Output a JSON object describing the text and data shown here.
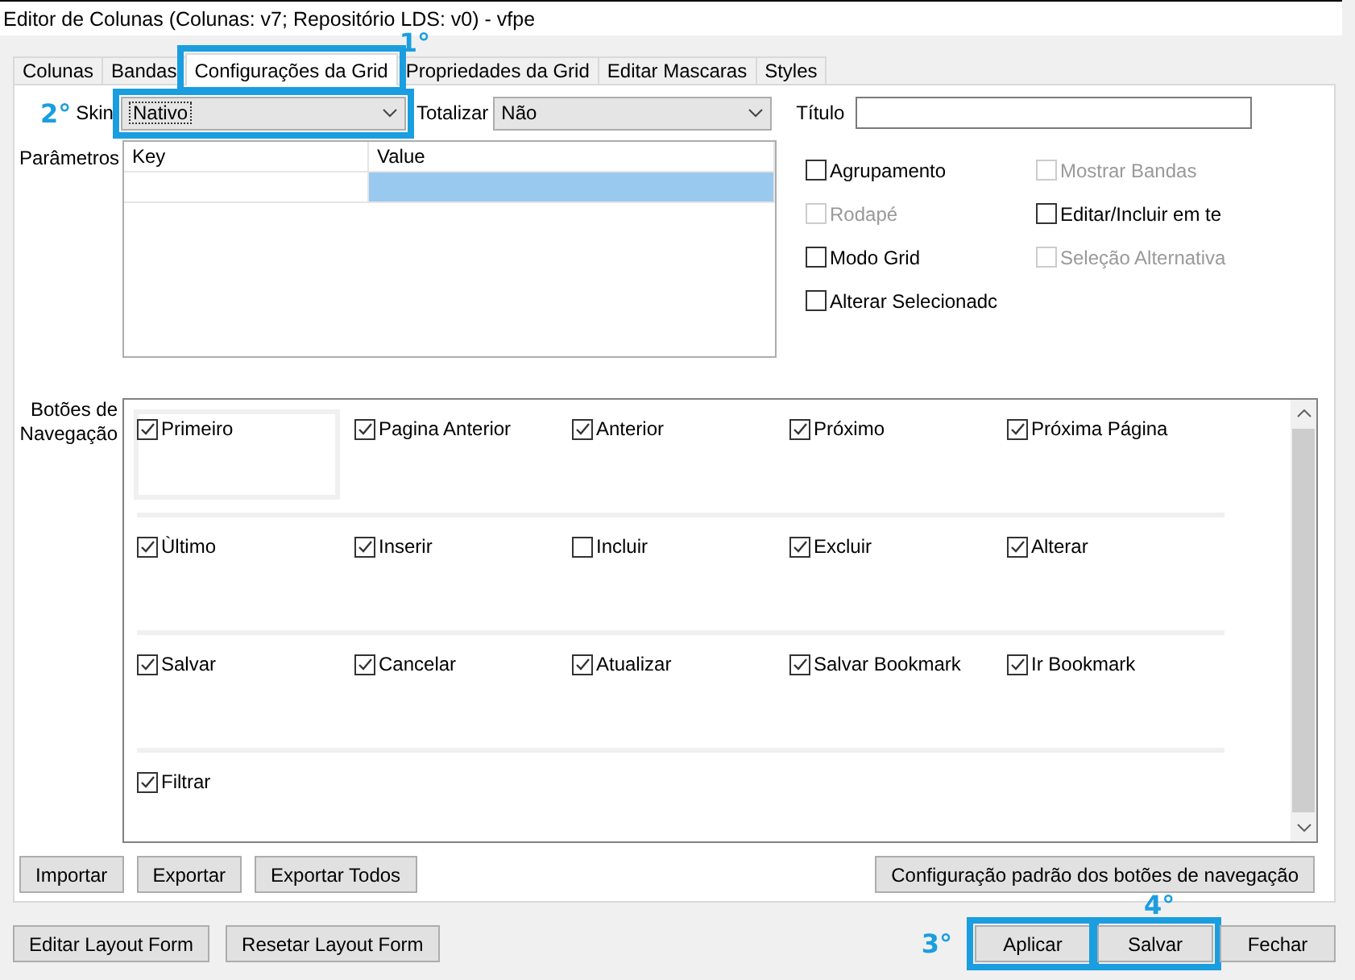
{
  "window": {
    "title": "Editor de Colunas (Colunas: v7; Repositório LDS: v0) - vfpe"
  },
  "tabs": [
    {
      "label": "Colunas",
      "selected": false
    },
    {
      "label": "Bandas",
      "selected": false
    },
    {
      "label": "Configurações da Grid",
      "selected": true,
      "callout": "1°"
    },
    {
      "label": "Propriedades da Grid",
      "selected": false
    },
    {
      "label": "Editar Mascaras",
      "selected": false
    },
    {
      "label": "Styles",
      "selected": false
    }
  ],
  "skin": {
    "label": "Skin",
    "value": "Nativo",
    "callout": "2°"
  },
  "totalizar": {
    "label": "Totalizar",
    "value": "Não"
  },
  "titulo": {
    "label": "Título"
  },
  "parametros": {
    "label": "Parâmetros",
    "columns": [
      "Key",
      "Value"
    ],
    "rows": [
      {
        "cells": [
          {
            "selected": false
          },
          {
            "selected": true
          }
        ]
      }
    ]
  },
  "options": [
    {
      "label": "Agrupamento",
      "checked": false,
      "disabled": false
    },
    {
      "label": "Mostrar Bandas",
      "checked": false,
      "disabled": true
    },
    {
      "label": "Rodapé",
      "checked": false,
      "disabled": true
    },
    {
      "label": "Editar/Incluir em te",
      "checked": false,
      "disabled": false
    },
    {
      "label": "Modo Grid",
      "checked": false,
      "disabled": false
    },
    {
      "label": "Seleção Alternativa",
      "checked": false,
      "disabled": true
    },
    {
      "label": "Alterar Selecionadc",
      "checked": false,
      "disabled": false
    }
  ],
  "navigation": {
    "label": "Botões de Navegação",
    "items": [
      {
        "label": "Primeiro",
        "checked": true,
        "focused": true
      },
      {
        "label": "Pagina Anterior",
        "checked": true,
        "focused": false
      },
      {
        "label": "Anterior",
        "checked": true,
        "focused": false
      },
      {
        "label": "Próximo",
        "checked": true,
        "focused": false
      },
      {
        "label": "Próxima Página",
        "checked": true,
        "focused": false
      },
      {
        "label": "Ùltimo",
        "checked": true,
        "focused": false
      },
      {
        "label": "Inserir",
        "checked": true,
        "focused": false
      },
      {
        "label": "Incluir",
        "checked": false,
        "focused": false
      },
      {
        "label": "Excluir",
        "checked": true,
        "focused": false
      },
      {
        "label": "Alterar",
        "checked": true,
        "focused": false
      },
      {
        "label": "Salvar",
        "checked": true,
        "focused": false
      },
      {
        "label": "Cancelar",
        "checked": true,
        "focused": false
      },
      {
        "label": "Atualizar",
        "checked": true,
        "focused": false
      },
      {
        "label": "Salvar Bookmark",
        "checked": true,
        "focused": false
      },
      {
        "label": "Ir Bookmark",
        "checked": true,
        "focused": false
      },
      {
        "label": "Filtrar",
        "checked": true,
        "focused": false
      }
    ]
  },
  "panel_buttons_left": [
    {
      "label": "Importar"
    },
    {
      "label": "Exportar"
    },
    {
      "label": "Exportar Todos"
    }
  ],
  "panel_buttons_right": [
    {
      "label": "Configuração padrão dos botões de navegação"
    }
  ],
  "footer_buttons_left": [
    {
      "label": "Editar Layout Form"
    },
    {
      "label": "Resetar Layout Form"
    }
  ],
  "footer_buttons_right": [
    {
      "label": "Aplicar",
      "callout": "3°"
    },
    {
      "label": "Salvar",
      "callout": "4°"
    },
    {
      "label": "Fechar"
    }
  ]
}
